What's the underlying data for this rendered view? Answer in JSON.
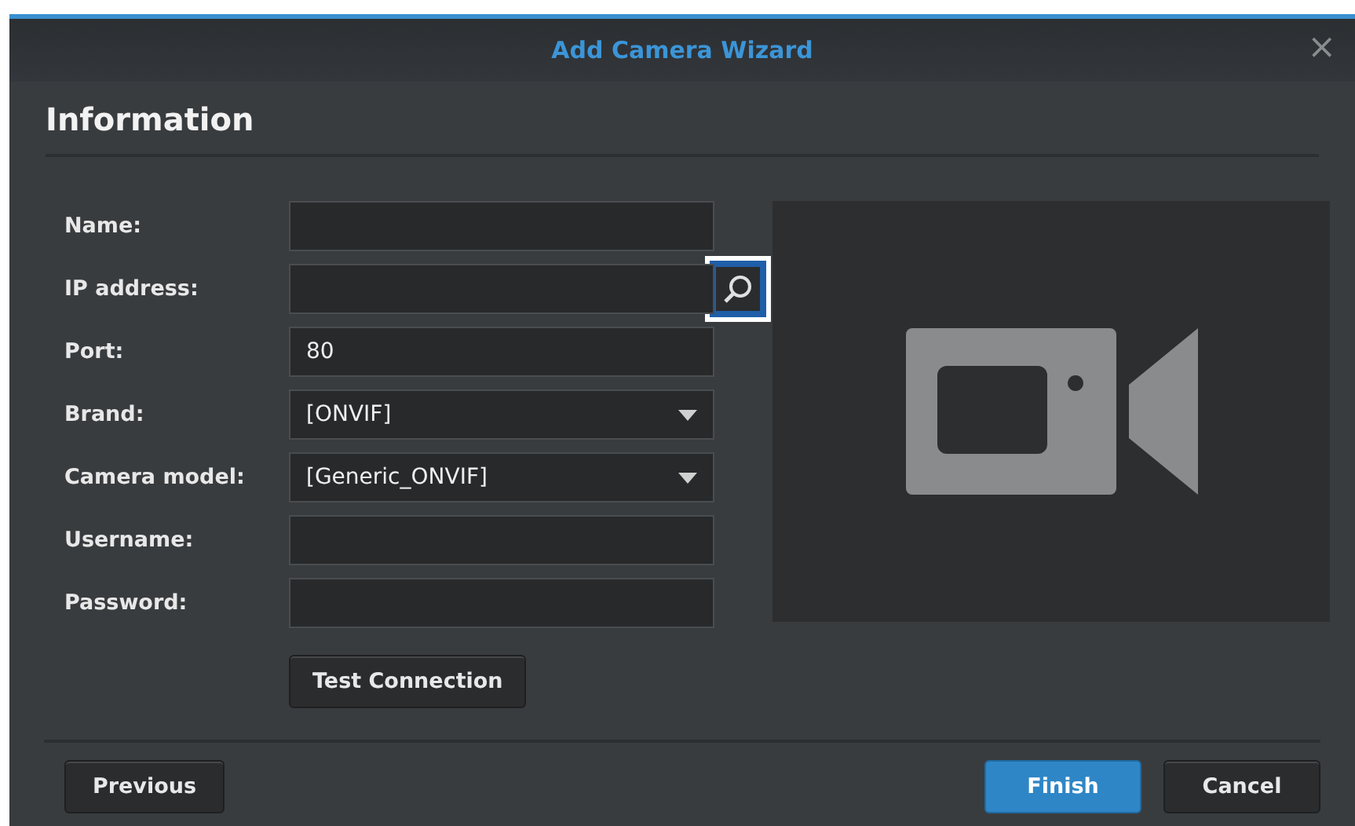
{
  "window": {
    "title": "Add Camera Wizard",
    "close": "×"
  },
  "heading": "Information",
  "fields": [
    {
      "label": "Name:",
      "kind": "text"
    },
    {
      "label": "IP address:",
      "kind": "search"
    },
    {
      "label": "Port:",
      "kind": "text",
      "value": "80"
    },
    {
      "label": "Brand:",
      "kind": "select",
      "value": "[ONVIF]"
    },
    {
      "label": "Camera model:",
      "kind": "select",
      "value": "[Generic_ONVIF]"
    },
    {
      "label": "Username:",
      "kind": "text"
    },
    {
      "label": "Password:",
      "kind": "password"
    }
  ],
  "test_button": "Test Connection",
  "footer": {
    "left": [
      "Previous"
    ],
    "right": [
      {
        "label": "Finish",
        "primary": true
      },
      {
        "label": "Cancel",
        "primary": false
      }
    ]
  }
}
